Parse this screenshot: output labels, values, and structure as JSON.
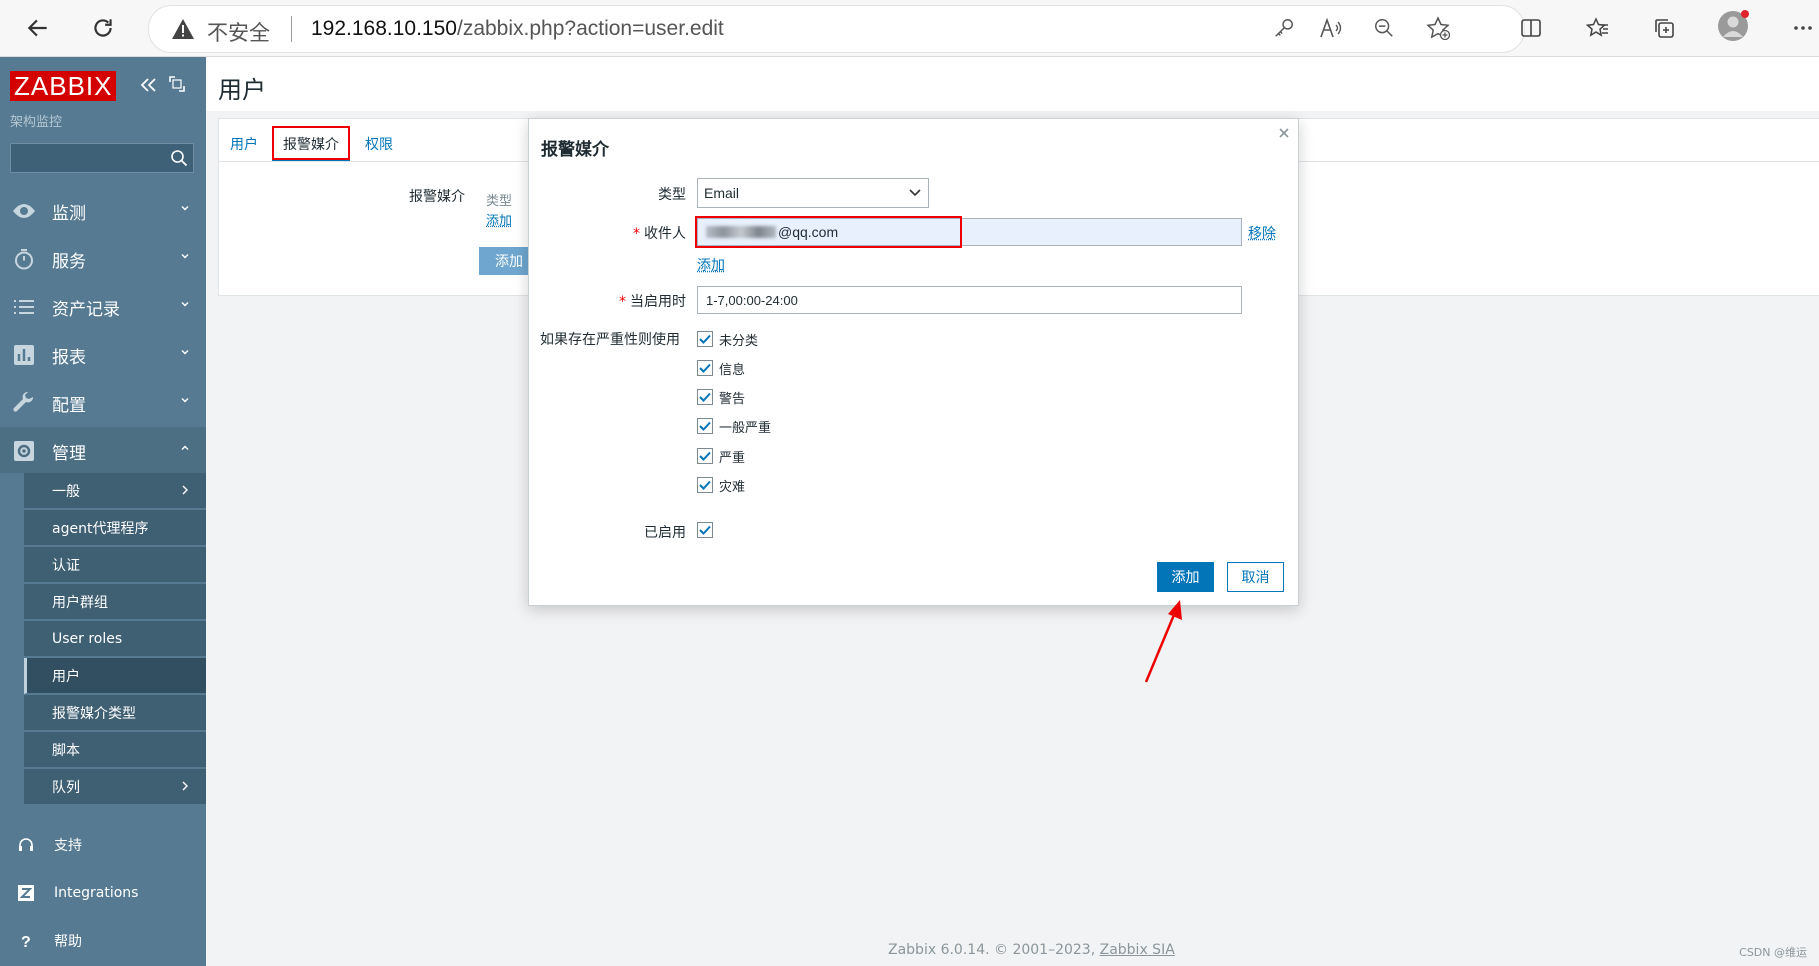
{
  "browser": {
    "insecure_label": "不安全",
    "url_host": "192.168.10.150",
    "url_path": "/zabbix.php?action=user.edit"
  },
  "sidebar": {
    "logo": "ZABBIX",
    "subtitle": "架构监控",
    "menu": [
      {
        "label": "监测",
        "icon": "eye-icon"
      },
      {
        "label": "服务",
        "icon": "stopwatch-icon"
      },
      {
        "label": "资产记录",
        "icon": "list-icon"
      },
      {
        "label": "报表",
        "icon": "bar-chart-icon"
      },
      {
        "label": "配置",
        "icon": "wrench-icon"
      },
      {
        "label": "管理",
        "icon": "gear-icon"
      }
    ],
    "admin_submenu": [
      "一般",
      "agent代理程序",
      "认证",
      "用户群组",
      "User roles",
      "用户",
      "报警媒介类型",
      "脚本",
      "队列"
    ],
    "footer": [
      {
        "label": "支持",
        "icon": "headset-icon"
      },
      {
        "label": "Integrations",
        "icon": "integrations-icon"
      },
      {
        "label": "帮助",
        "icon": "help-icon"
      }
    ]
  },
  "page": {
    "title": "用户",
    "tabs": [
      "用户",
      "报警媒介",
      "权限"
    ],
    "media_label": "报警媒介",
    "media_type_header": "类型",
    "media_add_link": "添加",
    "add_button": "添加"
  },
  "modal": {
    "title": "报警媒介",
    "type_label": "类型",
    "type_value": "Email",
    "recipient_label": "收件人",
    "recipient_value": "@qq.com",
    "remove_link": "移除",
    "recipient_add_link": "添加",
    "period_label": "当启用时",
    "period_value": "1-7,00:00-24:00",
    "severity_label": "如果存在严重性则使用",
    "severities": [
      "未分类",
      "信息",
      "警告",
      "一般严重",
      "严重",
      "灾难"
    ],
    "enabled_label": "已启用",
    "add_button": "添加",
    "cancel_button": "取消"
  },
  "footer": {
    "text": "Zabbix 6.0.14. © 2001–2023, ",
    "link": "Zabbix SIA",
    "watermark": "CSDN @维运"
  },
  "colors": {
    "sidebar_bg": "#557a91",
    "accent": "#0275b8",
    "logo_bg": "#d40000",
    "highlight_border": "#e00000"
  }
}
